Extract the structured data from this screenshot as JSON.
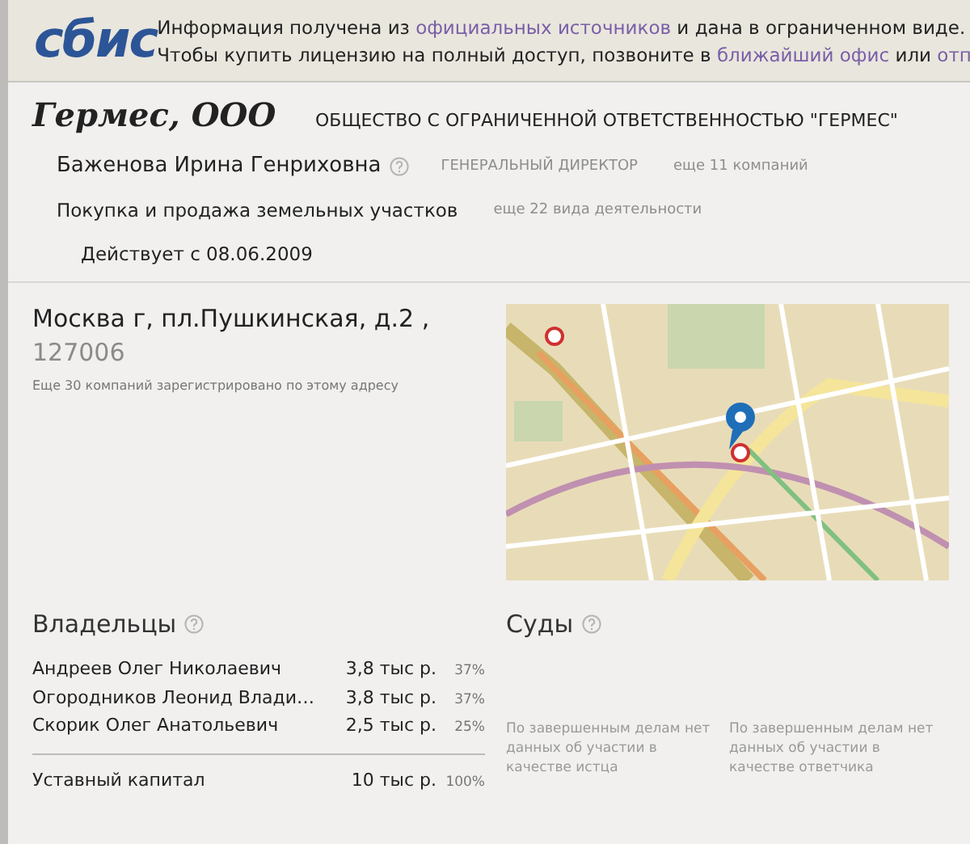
{
  "header": {
    "logo": "сбис",
    "lines": [
      [
        "Информация получена из ",
        {
          "link": "официальных источников"
        },
        " и дана в ограниченном виде."
      ],
      [
        "Чтобы купить лицензию на полный доступ, позвоните в ",
        {
          "link": "ближайший офис"
        },
        " или ",
        {
          "link": "отп"
        }
      ]
    ]
  },
  "company": {
    "short_name": "Гермес, ООО",
    "full_name": "ОБЩЕСТВО С ОГРАНИЧЕННОЙ ОТВЕТСТВЕННОСТЬЮ \"ГЕРМЕС\"",
    "director": {
      "name": "Баженова Ирина Генриховна",
      "position": "ГЕНЕРАЛЬНЫЙ ДИРЕКТОР",
      "more": "еще 11 компаний"
    },
    "activity": {
      "name": "Покупка и продажа земельных участков",
      "more": "еще 22 вида деятельности"
    },
    "status": "Действует с 08.06.2009"
  },
  "address": {
    "street": "Москва г, пл.Пушкинская, д.2 ,",
    "postcode": "127006",
    "note": "Еще 30 компаний зарегистрировано по этому адресу"
  },
  "owners": {
    "title": "Владельцы",
    "rows": [
      {
        "name": "Андреев Олег Николаевич",
        "amount": "3,8 тыс р.",
        "share": "37%"
      },
      {
        "name": "Огородников Леонид Влади…",
        "amount": "3,8 тыс р.",
        "share": "37%"
      },
      {
        "name": "Скорик Олег Анатольевич",
        "amount": "2,5 тыс р.",
        "share": "25%"
      }
    ],
    "total": {
      "name": "Уставный капитал",
      "amount": "10 тыс р.",
      "share": "100%"
    }
  },
  "courts": {
    "title": "Суды",
    "notes": [
      "По завершенным делам нет данных об участии в качестве истца",
      "По завершенным делам нет данных об участии в качестве ответчика"
    ]
  }
}
